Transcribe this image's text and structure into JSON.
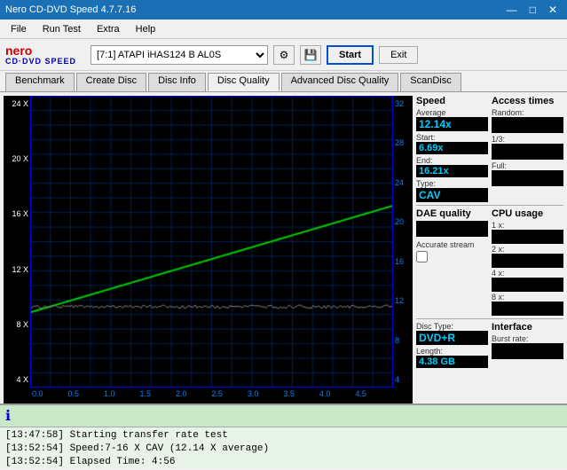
{
  "titlebar": {
    "title": "Nero CD-DVD Speed 4.7.7.16",
    "minimize": "—",
    "maximize": "□",
    "close": "✕"
  },
  "menubar": {
    "items": [
      "File",
      "Run Test",
      "Extra",
      "Help"
    ]
  },
  "toolbar": {
    "logo_nero": "nero",
    "logo_sub": "CD·DVD SPEED",
    "drive": "[7:1]  ATAPI iHAS124  B AL0S",
    "start_label": "Start",
    "exit_label": "Exit"
  },
  "tabs": {
    "items": [
      "Benchmark",
      "Create Disc",
      "Disc Info",
      "Disc Quality",
      "Advanced Disc Quality",
      "ScanDisc"
    ],
    "active": "Disc Quality"
  },
  "chart": {
    "y_left": [
      "24 X",
      "20 X",
      "16 X",
      "12 X",
      "8 X",
      "4 X"
    ],
    "y_right": [
      "32",
      "28",
      "24",
      "20",
      "16",
      "12",
      "8",
      "4"
    ],
    "x_labels": [
      "0.0",
      "0.5",
      "1.0",
      "1.5",
      "2.0",
      "2.5",
      "3.0",
      "3.5",
      "4.0",
      "4.5"
    ]
  },
  "speed_panel": {
    "title": "Speed",
    "average_label": "Average",
    "average_value": "12.14x",
    "start_label": "Start:",
    "start_value": "6.69x",
    "end_label": "End:",
    "end_value": "16.21x",
    "type_label": "Type:",
    "type_value": "CAV"
  },
  "access_times": {
    "title": "Access times",
    "random_label": "Random:",
    "onethird_label": "1/3:",
    "full_label": "Full:"
  },
  "cpu_usage": {
    "title": "CPU usage",
    "1x_label": "1 x:",
    "2x_label": "2 x:",
    "4x_label": "4 x:",
    "8x_label": "8 x:"
  },
  "dae_quality": {
    "title": "DAE quality",
    "accurate_stream_label": "Accurate stream"
  },
  "disc": {
    "type_label": "Disc Type:",
    "type_value": "DVD+R",
    "length_label": "Length:",
    "length_value": "4.38 GB"
  },
  "interface": {
    "title": "Interface",
    "burst_label": "Burst rate:"
  },
  "log": {
    "icon": "ℹ",
    "lines": [
      "[13:47:58]  Starting transfer rate test",
      "[13:52:54]  Speed:7-16 X CAV (12.14 X average)",
      "[13:52:54]  Elapsed Time: 4:56"
    ]
  }
}
